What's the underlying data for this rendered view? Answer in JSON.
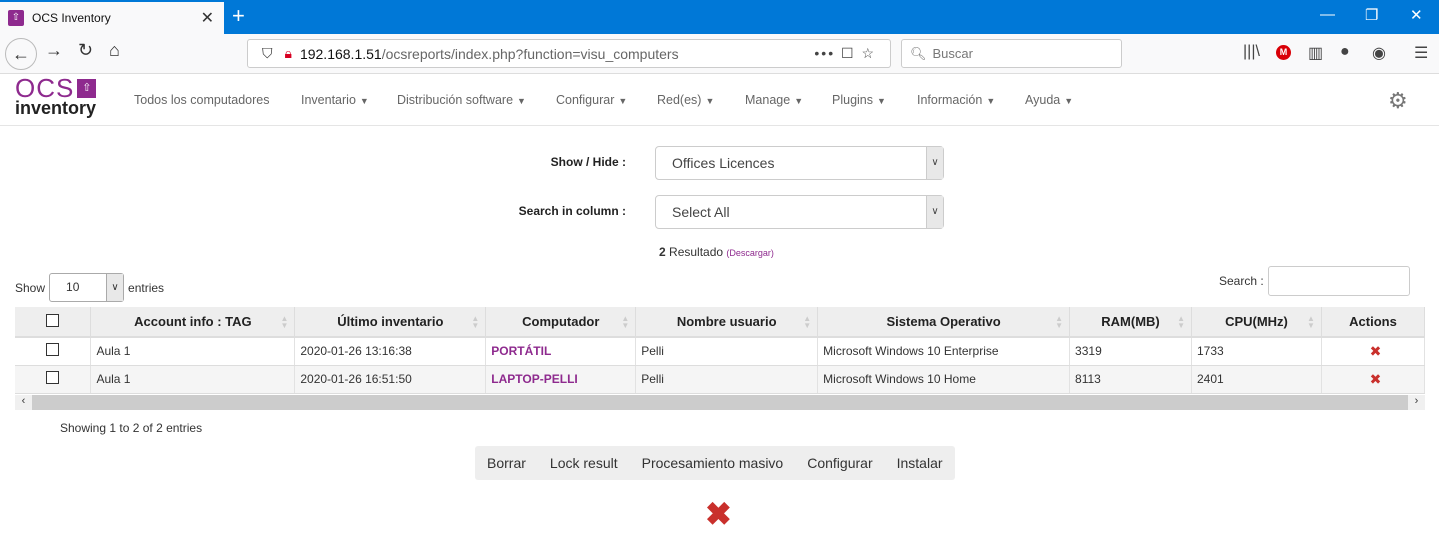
{
  "browser": {
    "tab_title": "OCS Inventory",
    "url_host": "192.168.1.51",
    "url_path": "/ocsreports/index.php?function=visu_computers",
    "search_placeholder": "Buscar"
  },
  "app": {
    "logo_top": "OCS",
    "logo_bottom": "inventory",
    "brand_color": "#8e2a8e",
    "menu": [
      {
        "label": "Todos los computadores",
        "dropdown": false
      },
      {
        "label": "Inventario",
        "dropdown": true
      },
      {
        "label": "Distribución software",
        "dropdown": true
      },
      {
        "label": "Configurar",
        "dropdown": true
      },
      {
        "label": "Red(es)",
        "dropdown": true
      },
      {
        "label": "Manage",
        "dropdown": true
      },
      {
        "label": "Plugins",
        "dropdown": true
      },
      {
        "label": "Información",
        "dropdown": true
      },
      {
        "label": "Ayuda",
        "dropdown": true
      }
    ]
  },
  "filters": {
    "show_hide_label": "Show / Hide :",
    "show_hide_value": "Offices Licences",
    "search_col_label": "Search in column :",
    "search_col_value": "Select All"
  },
  "results": {
    "count": "2",
    "label": "Resultado",
    "download": "(Descargar)"
  },
  "table": {
    "show_label": "Show",
    "entries_label": "entries",
    "length": "10",
    "search_label": "Search :",
    "columns": [
      "Account info : TAG",
      "Último inventario",
      "Computador",
      "Nombre usuario",
      "Sistema Operativo",
      "RAM(MB)",
      "CPU(MHz)",
      "Actions"
    ],
    "rows": [
      [
        "Aula 1",
        "2020-01-26 13:16:38",
        "PORTÁTIL",
        "Pelli",
        "Microsoft Windows 10 Enterprise",
        "3319",
        "1733"
      ],
      [
        "Aula 1",
        "2020-01-26 16:51:50",
        "LAPTOP-PELLI",
        "Pelli",
        "Microsoft Windows 10 Home",
        "8113",
        "2401"
      ]
    ],
    "info": "Showing 1 to 2 of 2 entries"
  },
  "actions": [
    "Borrar",
    "Lock result",
    "Procesamiento masivo",
    "Configurar",
    "Instalar"
  ]
}
